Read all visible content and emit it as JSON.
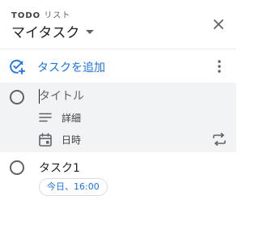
{
  "header": {
    "app_label_prefix": "TODO",
    "app_label_suffix": "リスト",
    "list_name": "マイタスク"
  },
  "add_task": {
    "label": "タスクを追加"
  },
  "editing_task": {
    "title_placeholder": "タイトル",
    "details_label": "詳細",
    "date_label": "日時"
  },
  "tasks": [
    {
      "title": "タスク1",
      "due": "今日、16:00"
    }
  ],
  "colors": {
    "accent": "#1a73e8",
    "edit_background": "#f1f3f4",
    "icon": "#5f6368",
    "divider": "#e8eaed"
  },
  "icons": {
    "close": "close-icon",
    "add_task": "add-task-icon",
    "more": "more-vert-icon",
    "details": "notes-icon",
    "date": "calendar-icon",
    "repeat": "repeat-icon"
  }
}
